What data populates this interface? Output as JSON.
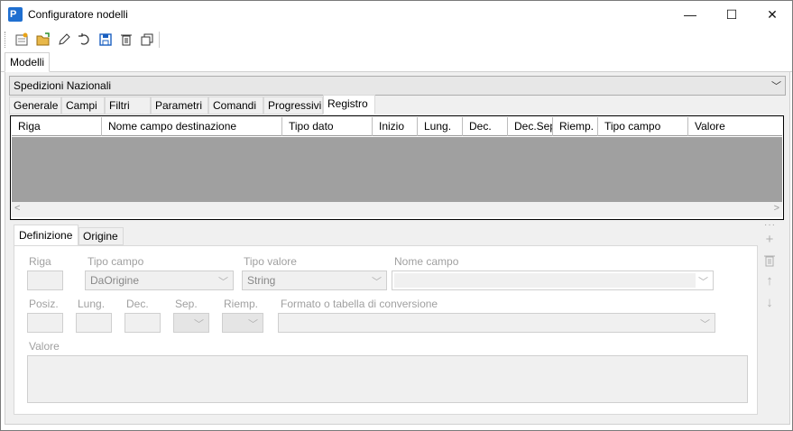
{
  "window": {
    "title": "Configuratore nodelli",
    "app_icon_letter": "P",
    "minimize": "—",
    "maximize": "☐",
    "close": "✕"
  },
  "toolbar": {
    "icons": [
      "new-icon",
      "open-icon",
      "edit-icon",
      "undo-icon",
      "save-icon",
      "delete-icon",
      "copy-icon"
    ]
  },
  "main_tab": "Modelli",
  "model_combo": {
    "value": "Spedizioni Nazionali"
  },
  "section_tabs": [
    "Generale",
    "Campi",
    "Filtri",
    "Parametri",
    "Comandi",
    "Progressivi",
    "Registro"
  ],
  "active_section_tab": "Registro",
  "grid": {
    "columns": [
      "Riga",
      "Nome campo destinazione",
      "Tipo dato",
      "Inizio",
      "Lung.",
      "Dec.",
      "Dec.Sep",
      "Riemp.",
      "Tipo campo",
      "Valore"
    ],
    "rows": []
  },
  "detail_tabs": [
    "Definizione",
    "Origine"
  ],
  "active_detail_tab": "Definizione",
  "definizione": {
    "riga_label": "Riga",
    "riga_value": "",
    "tipo_campo_label": "Tipo campo",
    "tipo_campo_value": "DaOrigine",
    "tipo_valore_label": "Tipo valore",
    "tipo_valore_value": "String",
    "nome_campo_label": "Nome campo",
    "nome_campo_value": "",
    "posiz_label": "Posiz.",
    "lung_label": "Lung.",
    "dec_label": "Dec.",
    "sep_label": "Sep.",
    "riemp_label": "Riemp.",
    "formato_label": "Formato o tabella di conversione",
    "valore_label": "Valore"
  },
  "side_buttons": [
    "add-icon",
    "trash-icon",
    "arrow-up-icon",
    "arrow-down-icon"
  ]
}
